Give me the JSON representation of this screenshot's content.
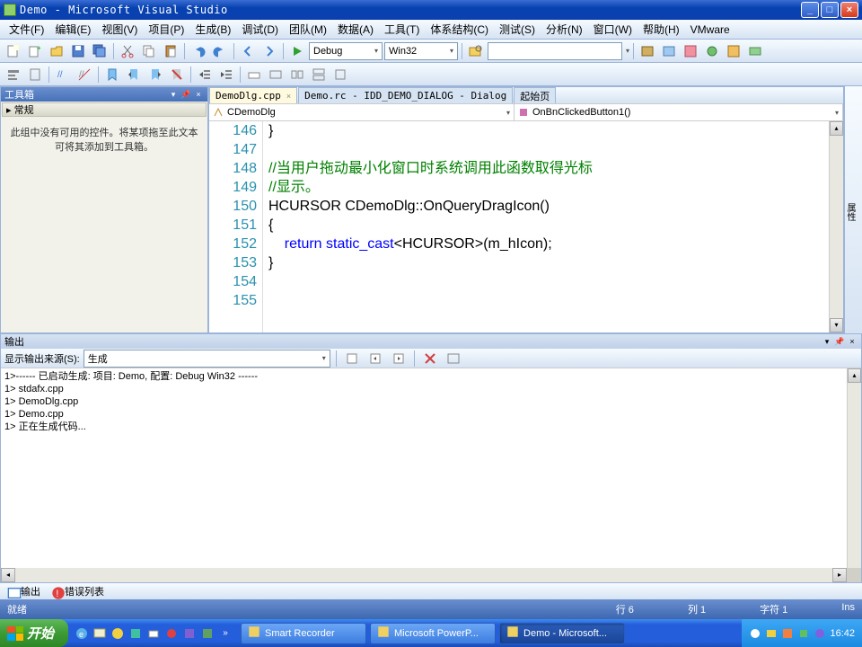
{
  "title": "Demo - Microsoft Visual Studio",
  "menu": [
    "文件(F)",
    "编辑(E)",
    "视图(V)",
    "项目(P)",
    "生成(B)",
    "调试(D)",
    "团队(M)",
    "数据(A)",
    "工具(T)",
    "体系结构(C)",
    "测试(S)",
    "分析(N)",
    "窗口(W)",
    "帮助(H)",
    "VMware"
  ],
  "toolbar1": {
    "config": "Debug",
    "platform": "Win32"
  },
  "toolbox": {
    "title": "工具箱",
    "sub": "▸ 常规",
    "body": "此组中没有可用的控件。将某项拖至此文本可将其添加到工具箱。"
  },
  "editor": {
    "tabs": [
      {
        "label": "DemoDlg.cpp",
        "active": true,
        "closable": true
      },
      {
        "label": "Demo.rc - IDD_DEMO_DIALOG - Dialog",
        "active": false
      },
      {
        "label": "起始页",
        "active": false
      }
    ],
    "classDrop": "CDemoDlg",
    "funcDrop": "OnBnClickedButton1()",
    "linesStart": 146,
    "code": [
      {
        "n": 146,
        "t": "}"
      },
      {
        "n": 147,
        "t": ""
      },
      {
        "n": 148,
        "t": "//当用户拖动最小化窗口时系统调用此函数取得光标",
        "cls": "com",
        "fold": true
      },
      {
        "n": 149,
        "t": "//显示。",
        "cls": "com"
      },
      {
        "n": 150,
        "t": "HCURSOR CDemoDlg::OnQueryDragIcon()",
        "fold": true
      },
      {
        "n": 151,
        "t": "{"
      },
      {
        "n": 152,
        "t": "    return static_cast<HCURSOR>(m_hIcon);",
        "kw": [
          "return",
          "static_cast"
        ]
      },
      {
        "n": 153,
        "t": "}"
      },
      {
        "n": 154,
        "t": ""
      },
      {
        "n": 155,
        "t": ""
      }
    ]
  },
  "output": {
    "title": "输出",
    "sourceLabel": "显示输出来源(S):",
    "source": "生成",
    "lines": [
      "1>------ 已启动生成: 项目: Demo, 配置: Debug Win32 ------",
      "1>  stdafx.cpp",
      "1>  DemoDlg.cpp",
      "1>  Demo.cpp",
      "1>  正在生成代码..."
    ],
    "tabs": [
      {
        "label": "输出",
        "ico": "out"
      },
      {
        "label": "错误列表",
        "ico": "err"
      }
    ]
  },
  "status": {
    "ready": "就绪",
    "line": "行 6",
    "col": "列 1",
    "char": "字符 1",
    "ins": "Ins"
  },
  "taskbar": {
    "start": "开始",
    "buttons": [
      {
        "label": "Smart Recorder",
        "active": false
      },
      {
        "label": "Microsoft PowerP...",
        "active": false
      },
      {
        "label": "Demo - Microsoft...",
        "active": true
      }
    ],
    "time": "16:42"
  },
  "rightstrip": "属性"
}
